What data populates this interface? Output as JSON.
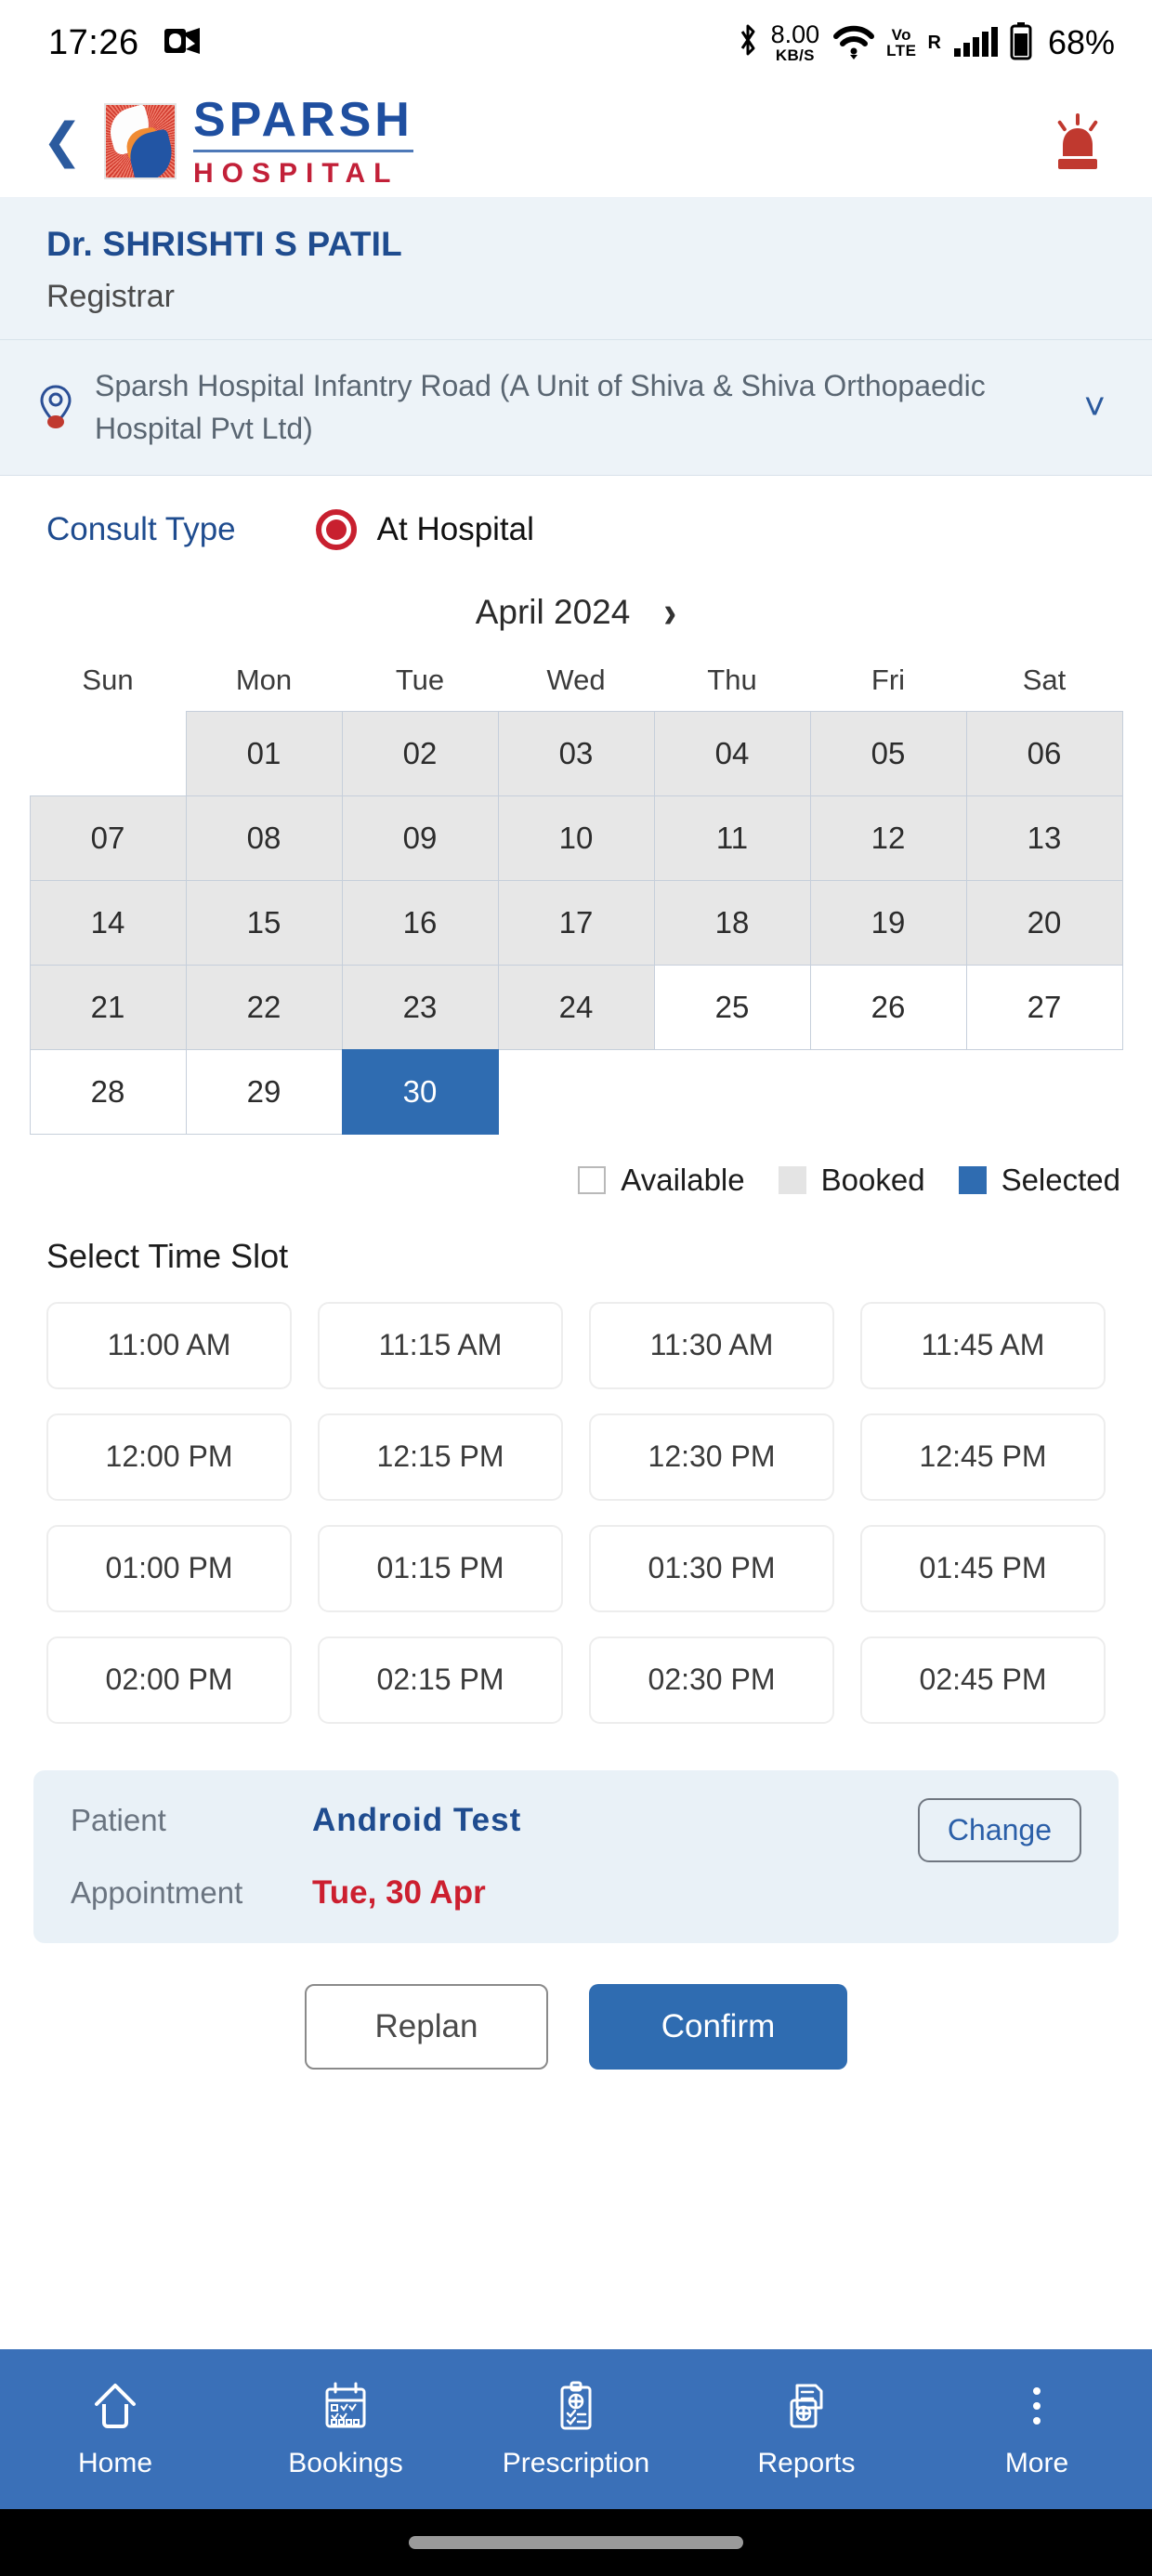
{
  "status_bar": {
    "time": "17:26",
    "app_icon": "outlook-icon",
    "bluetooth_icon": "bluetooth-icon",
    "net_speed_value": "8.00",
    "net_speed_unit": "KB/S",
    "wifi_icon": "wifi-icon",
    "volte_top": "Vo",
    "volte_bottom": "LTE",
    "roaming": "R",
    "signal_icon": "signal-bars-icon",
    "battery_icon": "battery-icon",
    "battery_percent": "68%"
  },
  "app_bar": {
    "back_icon": "back-chevron-icon",
    "brand_top": "SPARSH",
    "brand_bottom": "HOSPITAL",
    "logo_icon": "sparsh-logo-icon",
    "emergency_icon": "emergency-siren-icon"
  },
  "doctor": {
    "name": "Dr. SHRISHTI S PATIL",
    "role": "Registrar",
    "location_icon": "location-pin-icon",
    "location": "Sparsh Hospital Infantry Road (A Unit of Shiva & Shiva Orthopaedic Hospital Pvt Ltd)",
    "location_chevron": "chevron-down-icon"
  },
  "consult": {
    "label": "Consult Type",
    "option_label": "At Hospital",
    "selected": true
  },
  "calendar": {
    "month": "April 2024",
    "next_icon": "chevron-right-icon",
    "day_headers": [
      "Sun",
      "Mon",
      "Tue",
      "Wed",
      "Thu",
      "Fri",
      "Sat"
    ],
    "weeks": [
      [
        {
          "label": "",
          "state": "empty"
        },
        {
          "label": "01",
          "state": "booked"
        },
        {
          "label": "02",
          "state": "booked"
        },
        {
          "label": "03",
          "state": "booked"
        },
        {
          "label": "04",
          "state": "booked"
        },
        {
          "label": "05",
          "state": "booked"
        },
        {
          "label": "06",
          "state": "booked"
        }
      ],
      [
        {
          "label": "07",
          "state": "booked"
        },
        {
          "label": "08",
          "state": "booked"
        },
        {
          "label": "09",
          "state": "booked"
        },
        {
          "label": "10",
          "state": "booked"
        },
        {
          "label": "11",
          "state": "booked"
        },
        {
          "label": "12",
          "state": "booked"
        },
        {
          "label": "13",
          "state": "booked"
        }
      ],
      [
        {
          "label": "14",
          "state": "booked"
        },
        {
          "label": "15",
          "state": "booked"
        },
        {
          "label": "16",
          "state": "booked"
        },
        {
          "label": "17",
          "state": "booked"
        },
        {
          "label": "18",
          "state": "booked"
        },
        {
          "label": "19",
          "state": "booked"
        },
        {
          "label": "20",
          "state": "booked"
        }
      ],
      [
        {
          "label": "21",
          "state": "booked"
        },
        {
          "label": "22",
          "state": "booked"
        },
        {
          "label": "23",
          "state": "booked"
        },
        {
          "label": "24",
          "state": "booked"
        },
        {
          "label": "25",
          "state": "available"
        },
        {
          "label": "26",
          "state": "available"
        },
        {
          "label": "27",
          "state": "available"
        }
      ],
      [
        {
          "label": "28",
          "state": "available"
        },
        {
          "label": "29",
          "state": "available"
        },
        {
          "label": "30",
          "state": "selected"
        },
        {
          "label": "",
          "state": "empty"
        },
        {
          "label": "",
          "state": "empty"
        },
        {
          "label": "",
          "state": "empty"
        },
        {
          "label": "",
          "state": "empty"
        }
      ]
    ],
    "legend": [
      {
        "label": "Available",
        "state": "available"
      },
      {
        "label": "Booked",
        "state": "booked"
      },
      {
        "label": "Selected",
        "state": "selected"
      }
    ]
  },
  "time_slots": {
    "title": "Select Time Slot",
    "slots": [
      "11:00 AM",
      "11:15 AM",
      "11:30 AM",
      "11:45 AM",
      "12:00 PM",
      "12:15 PM",
      "12:30 PM",
      "12:45 PM",
      "01:00 PM",
      "01:15 PM",
      "01:30 PM",
      "01:45 PM",
      "02:00 PM",
      "02:15 PM",
      "02:30 PM",
      "02:45 PM"
    ]
  },
  "summary": {
    "patient_key": "Patient",
    "patient_value": "Android  Test",
    "change_label": "Change",
    "appointment_key": "Appointment",
    "appointment_value": "Tue, 30 Apr"
  },
  "actions": {
    "replan_label": "Replan",
    "confirm_label": "Confirm"
  },
  "bottom_nav": [
    {
      "label": "Home",
      "icon": "home-icon"
    },
    {
      "label": "Bookings",
      "icon": "calendar-icon"
    },
    {
      "label": "Prescription",
      "icon": "prescription-clipboard-icon"
    },
    {
      "label": "Reports",
      "icon": "reports-documents-icon"
    },
    {
      "label": "More",
      "icon": "more-dots-icon"
    }
  ],
  "colors": {
    "brand_blue": "#1f4fa0",
    "brand_red": "#c22038",
    "selected_blue": "#2f6cb1",
    "nav_blue": "#3a70b8",
    "panel_bg": "#edf3f8",
    "booked_gray": "#e7e7e7",
    "appointment_red": "#cc1f2f"
  }
}
